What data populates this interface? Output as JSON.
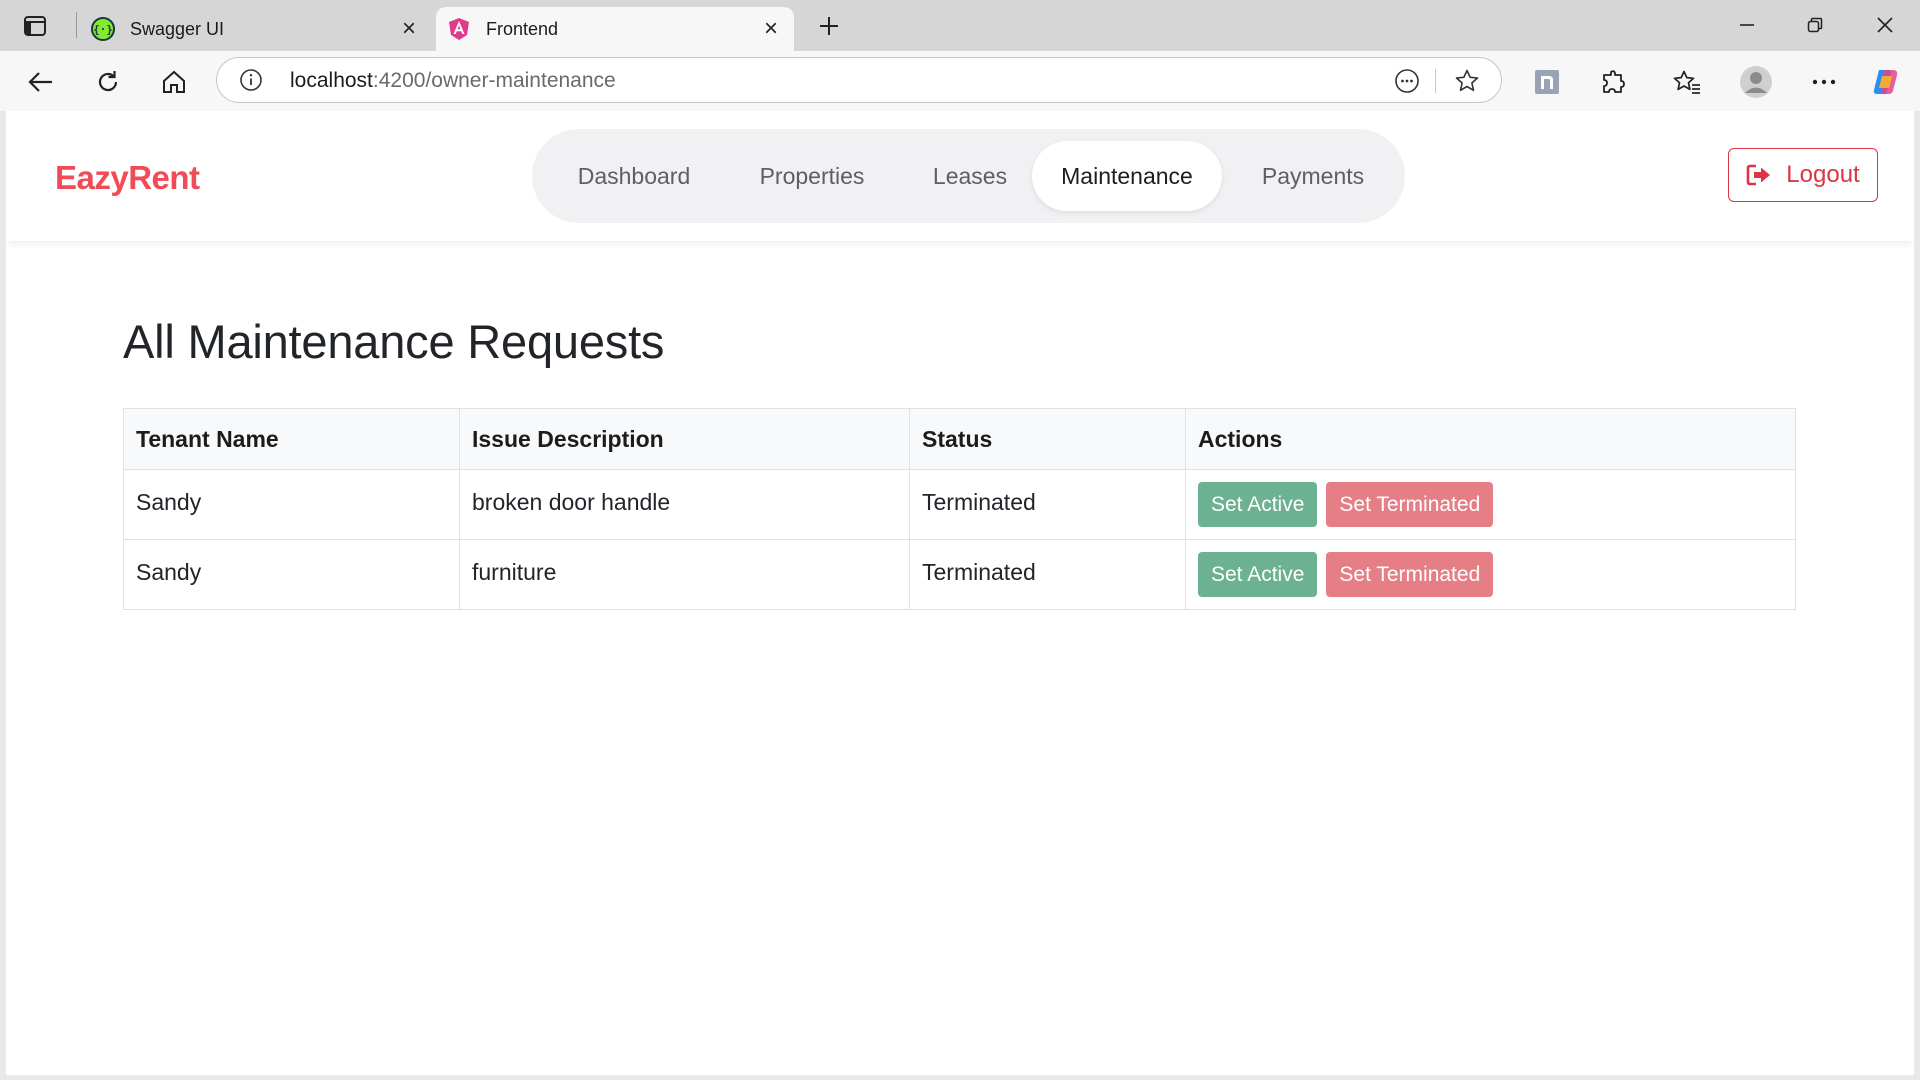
{
  "browser": {
    "tabs": [
      {
        "title": "Swagger UI",
        "active": false,
        "favicon": "swagger-icon"
      },
      {
        "title": "Frontend",
        "active": true,
        "favicon": "angular-icon"
      }
    ],
    "url_host": "localhost",
    "url_path": ":4200/owner-maintenance"
  },
  "app": {
    "brand": "EazyRent",
    "brand_color": "#f24b55",
    "nav": [
      {
        "label": "Dashboard",
        "active": false
      },
      {
        "label": "Properties",
        "active": false
      },
      {
        "label": "Leases",
        "active": false
      },
      {
        "label": "Maintenance",
        "active": true
      },
      {
        "label": "Payments",
        "active": false
      }
    ],
    "logout_label": "Logout"
  },
  "main": {
    "title": "All Maintenance Requests",
    "table": {
      "headers": [
        "Tenant Name",
        "Issue Description",
        "Status",
        "Actions"
      ],
      "rows": [
        {
          "tenant": "Sandy",
          "issue": "broken door handle",
          "status": "Terminated"
        },
        {
          "tenant": "Sandy",
          "issue": "furniture",
          "status": "Terminated"
        }
      ],
      "actions": {
        "set_active": "Set Active",
        "set_terminated": "Set Terminated"
      }
    }
  },
  "colors": {
    "active_button": "#6cb192",
    "terminate_button": "#e67e86",
    "logout": "#dc3545"
  }
}
